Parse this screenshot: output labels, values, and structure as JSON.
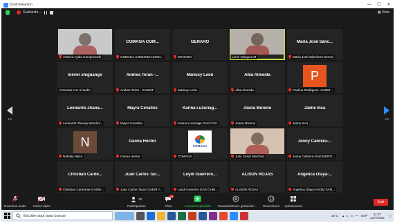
{
  "titlebar": {
    "title": "Zoom Reunión",
    "min": "—",
    "max": "☐",
    "close": "✕"
  },
  "topstrip": {
    "recording_label": "Grabando...",
    "view_label": "Vista"
  },
  "nav": {
    "page_left": "1/2",
    "page_right": "1/2"
  },
  "tiles": [
    {
      "big": "",
      "label": "Jessica Ayala Campoverde",
      "muted": true,
      "type": "photo",
      "photo_color": "#c9c9c9"
    },
    {
      "big": "COMAGA COM...",
      "label": "COMAGA COMUNICACION...",
      "muted": true,
      "type": "name"
    },
    {
      "big": "GENARO",
      "label": "GENARO",
      "muted": true,
      "type": "name"
    },
    {
      "big": "",
      "label": "Lenin Vasquez M",
      "muted": false,
      "type": "photo",
      "photo_color": "#b5b0a8",
      "speaking": true
    },
    {
      "big": "María José Sánc...",
      "label": "María José Sánchez Herrera",
      "muted": true,
      "type": "name"
    },
    {
      "big": "klever shiguango",
      "label": "Conectar con el audio",
      "muted": false,
      "type": "name"
    },
    {
      "big": "Andres Teran -...",
      "label": "Andres Teran - GADMT",
      "muted": true,
      "type": "name"
    },
    {
      "big": "Mariuxy León",
      "label": "Mariuxy León",
      "muted": true,
      "type": "name"
    },
    {
      "big": "Alba Almeida",
      "label": "Alba Almeida",
      "muted": true,
      "type": "name"
    },
    {
      "big": "",
      "label": "Paulina Rodriguez- GADM ...",
      "muted": true,
      "type": "avatar",
      "avatar_letter": "P",
      "avatar_color": "#e8541e"
    },
    {
      "big": "Leonardo Zhana...",
      "label": "Leonardo Zhanay Mendoz...",
      "muted": true,
      "type": "name"
    },
    {
      "big": "Mayra Cevallos",
      "label": "Mayra Cevallos",
      "muted": true,
      "type": "name"
    },
    {
      "big": "Karina Luzuriag...",
      "label": "Karina Luzuriaga GAD CCC",
      "muted": true,
      "type": "name"
    },
    {
      "big": "Joana Moreno",
      "label": "Joana Moreno",
      "muted": true,
      "type": "name"
    },
    {
      "big": "Jaime Inca",
      "label": "Jaime Inca",
      "muted": true,
      "type": "name"
    },
    {
      "big": "",
      "label": "Nathaly Maza",
      "muted": true,
      "type": "avatar",
      "avatar_letter": "N",
      "avatar_color": "#6b4a3a"
    },
    {
      "big": "Gaona Hector",
      "label": "Gaona Hector",
      "muted": true,
      "type": "name"
    },
    {
      "big": "",
      "label": "COMAGA",
      "muted": true,
      "type": "logo",
      "logo_text": "COMAGA"
    },
    {
      "big": "",
      "label": "Julio Cesar Merchan",
      "muted": true,
      "type": "photo",
      "photo_color": "#d6c2b0"
    },
    {
      "big": "Jenny Cabrera-...",
      "label": "Jenny Cabrera-GAD MORO...",
      "muted": true,
      "type": "name"
    },
    {
      "big": "Christian Carde...",
      "label": "Christian Cardenas-GADM-...",
      "muted": true,
      "type": "name"
    },
    {
      "big": "Juan Carlos Tac...",
      "label": "Juan Carlos Tacuri GADM Y...",
      "muted": true,
      "type": "name"
    },
    {
      "big": "Leydi Guerrero...",
      "label": "Leydi Guerrero GAD CHIN...",
      "muted": true,
      "type": "name"
    },
    {
      "big": "ALISON ROJAS",
      "label": "ALISON ROJAS",
      "muted": true,
      "type": "name"
    },
    {
      "big": "Angelica Olaya-...",
      "label": "Angelica Olaya-GADM SAN...",
      "muted": true,
      "type": "name"
    }
  ],
  "toolbar": {
    "audio": "Reactivar audio",
    "video": "Iniciar video",
    "participants": "Participantes",
    "participants_count": "30",
    "chat": "Chat",
    "chat_badge": "14",
    "share": "Compartir pantalla",
    "record": "Pausar/detener grabación",
    "reactions": "Reacciones",
    "apps": "Aplicaciones",
    "leave": "Salir"
  },
  "taskbar": {
    "search_placeholder": "Escribe aquí para buscar",
    "temperature": "15°C",
    "language": "ESP",
    "time": "11:07",
    "date": "21/7/2022"
  }
}
